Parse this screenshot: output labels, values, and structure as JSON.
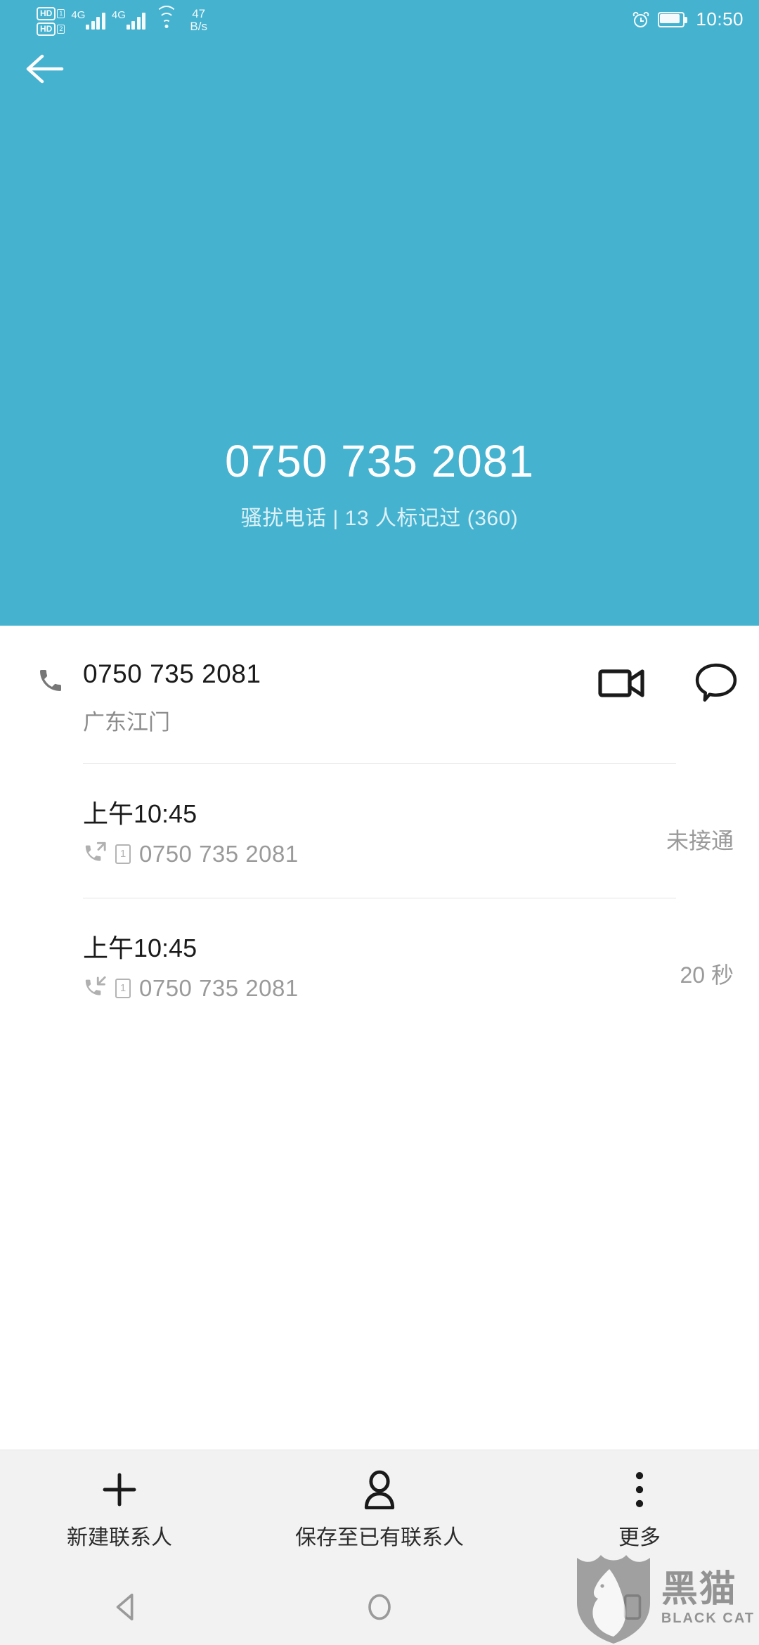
{
  "statusbar": {
    "hd1_label": "HD",
    "hd1_sim": "1",
    "hd2_label": "HD",
    "hd2_sim": "2",
    "net1": "4G",
    "net2": "4G",
    "speed_value": "47",
    "speed_unit": "B/s",
    "clock": "10:50",
    "alarm_icon": "alarm-clock-icon",
    "battery_icon": "battery-icon",
    "wifi_icon": "wifi-icon"
  },
  "header": {
    "back_icon": "back-arrow-icon",
    "phone_number": "0750 735 2081",
    "subtitle": "骚扰电话 | 13 人标记过 (360)",
    "bg_color": "#45b2d0"
  },
  "contact": {
    "phone_icon": "phone-handset-icon",
    "number": "0750 735 2081",
    "location": "广东江门",
    "video_icon": "video-camera-icon",
    "message_icon": "message-bubble-icon"
  },
  "call_log": [
    {
      "time": "上午10:45",
      "direction_icon": "outgoing-call-icon",
      "sim": "1",
      "number": "0750 735 2081",
      "status": "未接通"
    },
    {
      "time": "上午10:45",
      "direction_icon": "incoming-call-icon",
      "sim": "1",
      "number": "0750 735 2081",
      "status": "20 秒"
    }
  ],
  "toolbar": [
    {
      "icon": "plus-icon",
      "label": "新建联系人"
    },
    {
      "icon": "person-icon",
      "label": "保存至已有联系人"
    },
    {
      "icon": "more-vertical-icon",
      "label": "更多"
    }
  ],
  "navbar": {
    "back_icon": "nav-back-triangle-icon",
    "home_icon": "nav-home-circle-icon",
    "recents_icon": "nav-recents-square-icon"
  },
  "watermark": {
    "cn": "黑猫",
    "en": "BLACK CAT",
    "logo_icon": "black-cat-shield-logo-icon"
  }
}
